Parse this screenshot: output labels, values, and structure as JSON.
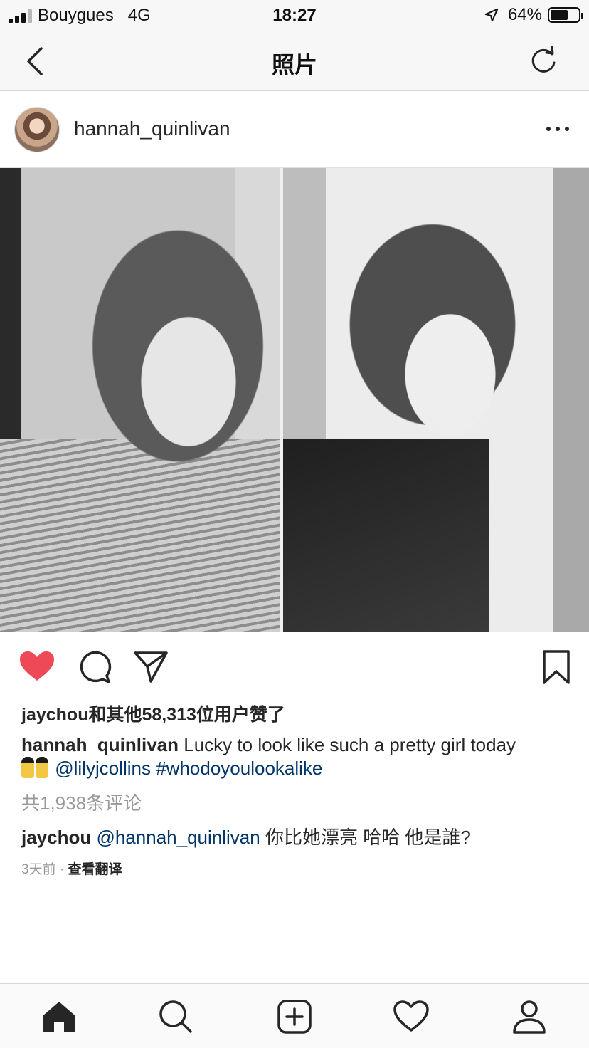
{
  "status_bar": {
    "carrier": "Bouygues",
    "network": "4G",
    "time": "18:27",
    "battery": "64%",
    "battery_level": 0.64
  },
  "header": {
    "title": "照片"
  },
  "post": {
    "username": "hannah_quinlivan",
    "likes_text": "jaychou和其他58,313位用户赞了",
    "caption": {
      "username": "hannah_quinlivan",
      "text": "Lucky to look like such a pretty girl today",
      "emoji": "👯",
      "mention": "@lilyjcollins",
      "hashtag": "#whodoyoulookalike"
    },
    "comments_count": "共1,938条评论",
    "top_comment": {
      "username": "jaychou",
      "mention": "@hannah_quinlivan",
      "text": "你比她漂亮 哈哈 他是誰?"
    },
    "time_ago": "3天前",
    "separator": "·",
    "translate_label": "查看翻译"
  },
  "colors": {
    "like_active": "#ED4956",
    "link": "#003569",
    "muted": "#999999",
    "text": "#262626"
  },
  "icons": {
    "nav": [
      "back-chevron-icon",
      "refresh-icon"
    ],
    "actions": [
      "heart-icon",
      "comment-icon",
      "share-icon",
      "bookmark-icon"
    ],
    "tabs": [
      "home-icon",
      "search-icon",
      "add-icon",
      "activity-heart-icon",
      "profile-icon"
    ]
  }
}
